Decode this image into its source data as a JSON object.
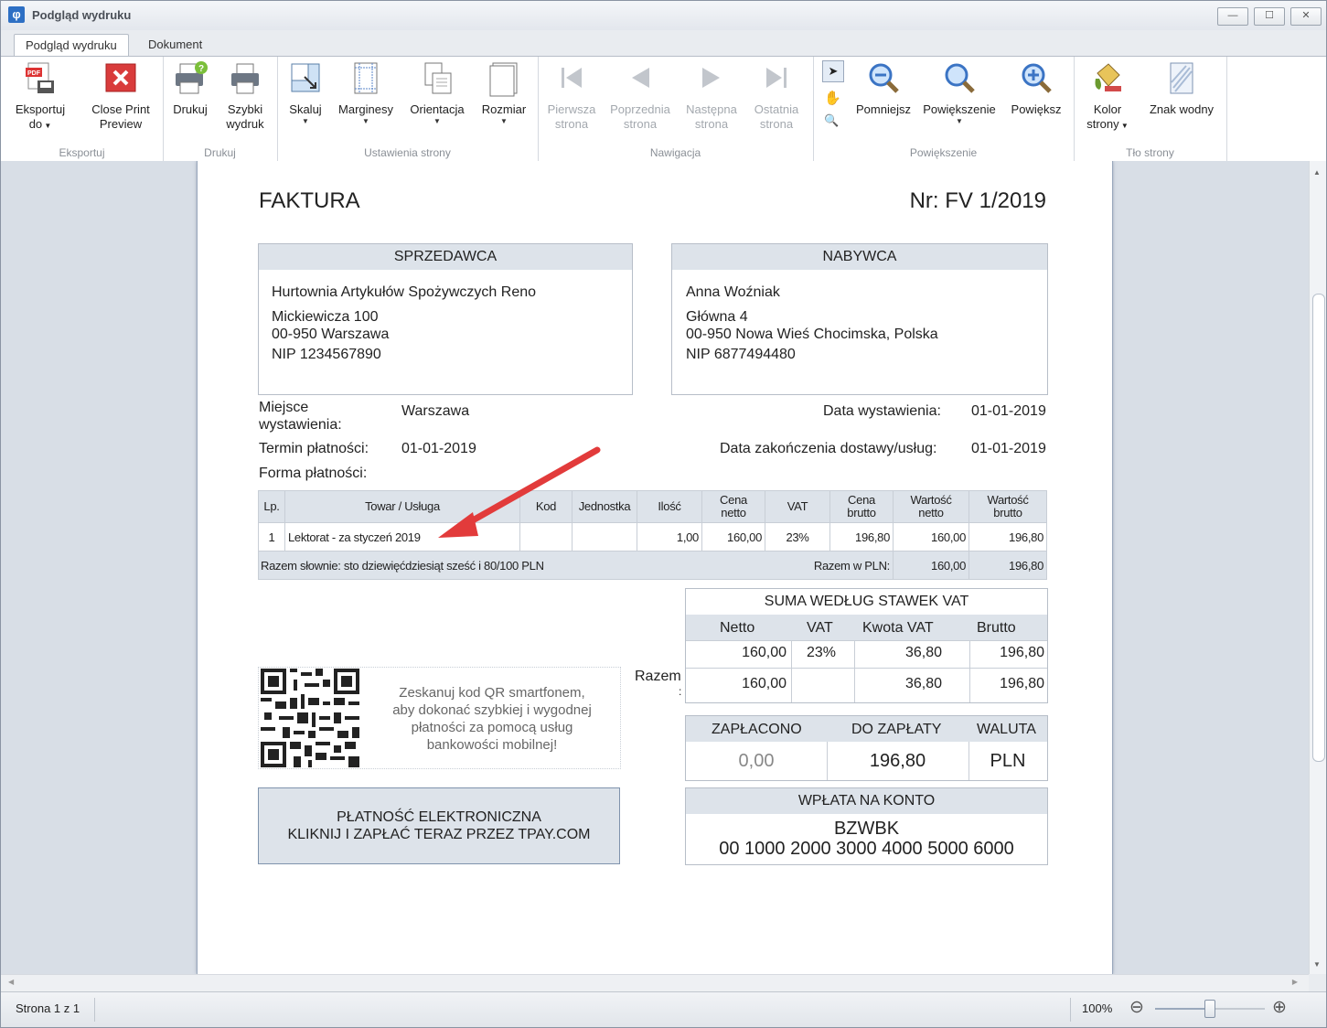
{
  "window": {
    "title": "Podgląd wydruku",
    "min": "—",
    "max": "☐",
    "close": "✕"
  },
  "tabs": [
    "Podgląd wydruku",
    "Dokument"
  ],
  "ribbon": {
    "eksport": {
      "label": "Eksportuj",
      "export": "Eksportuj do",
      "close": "Close Print Preview",
      "export_l1": "Eksportuj",
      "export_l2": "do",
      "close_l1": "Close Print",
      "close_l2": "Preview"
    },
    "druk": {
      "label": "Drukuj",
      "print": "Drukuj",
      "quick_l1": "Szybki",
      "quick_l2": "wydruk"
    },
    "ustawienia": {
      "label": "Ustawienia strony",
      "scale": "Skaluj",
      "margins": "Marginesy",
      "orientation": "Orientacja",
      "size": "Rozmiar"
    },
    "nawigacja": {
      "label": "Nawigacja",
      "first_l1": "Pierwsza",
      "first_l2": "strona",
      "prev_l1": "Poprzednia",
      "prev_l2": "strona",
      "next_l1": "Następna",
      "next_l2": "strona",
      "last_l1": "Ostatnia",
      "last_l2": "strona"
    },
    "powiekszenie": {
      "label": "Powiększenie",
      "zoom_out": "Pomniejsz",
      "zoom": "Powiększenie",
      "zoom_in": "Powiększ"
    },
    "tlo": {
      "label": "Tło strony",
      "color_l1": "Kolor",
      "color_l2": "strony",
      "watermark": "Znak wodny"
    }
  },
  "invoice": {
    "title": "FAKTURA",
    "number": "Nr: FV 1/2019",
    "seller": {
      "header": "SPRZEDAWCA",
      "name": "Hurtownia Artykułów Spożywczych Reno",
      "street": "Mickiewicza 100",
      "city": "00-950 Warszawa",
      "nip": "NIP 1234567890"
    },
    "buyer": {
      "header": "NABYWCA",
      "name": "Anna Woźniak",
      "street": "Główna 4",
      "city": "00-950 Nowa Wieś  Chocimska, Polska",
      "nip": "NIP 6877494480"
    },
    "place_label_1": "Miejsce",
    "place_label_2": "wystawienia:",
    "place_value": "Warszawa",
    "issue_label": "Data wystawienia:",
    "issue_value": "01-01-2019",
    "term_label": "Termin płatności:",
    "term_value": "01-01-2019",
    "delivery_label": "Data zakończenia dostawy/usług:",
    "delivery_value": "01-01-2019",
    "payment_label": "Forma płatności:",
    "table": {
      "headers": [
        "Lp.",
        "Towar / Usługa",
        "Kod",
        "Jednostka",
        "Ilość",
        "Cena netto",
        "VAT",
        "Cena brutto",
        "Wartość netto",
        "Wartość brutto"
      ],
      "h_cena_netto": [
        "Cena",
        "netto"
      ],
      "h_cena_brutto": [
        "Cena",
        "brutto"
      ],
      "h_wart_netto": [
        "Wartość",
        "netto"
      ],
      "h_wart_brutto": [
        "Wartość",
        "brutto"
      ],
      "row": {
        "lp": "1",
        "name": "Lektorat - za styczeń 2019",
        "kod": "",
        "jm": "",
        "qty": "1,00",
        "cena_netto": "160,00",
        "vat": "23%",
        "cena_brutto": "196,80",
        "wart_netto": "160,00",
        "wart_brutto": "196,80"
      },
      "words": "Razem słownie: sto dziewięćdziesiąt sześć i 80/100 PLN",
      "sum_label": "Razem w PLN:",
      "sum_netto": "160,00",
      "sum_brutto": "196,80"
    },
    "vat_summary": {
      "title": "SUMA WEDŁUG STAWEK VAT",
      "headers": [
        "Netto",
        "VAT",
        "Kwota VAT",
        "Brutto"
      ],
      "row": {
        "netto": "160,00",
        "vat": "23%",
        "kwota": "36,80",
        "brutto": "196,80"
      },
      "total_label": "Razem",
      "total_colon": ":",
      "total": {
        "netto": "160,00",
        "kwota": "36,80",
        "brutto": "196,80"
      }
    },
    "qr_text": "Zeskanuj kod QR smartfonem, aby dokonać szybkiej i wygodnej płatności za pomocą usług bankowości mobilnej!",
    "qr_lines": [
      "Zeskanuj kod QR smartfonem,",
      "aby dokonać szybkiej i wygodnej",
      "płatności za pomocą usług",
      "bankowości mobilnej!"
    ],
    "paid": {
      "h1": "ZAPŁACONO",
      "h2": "DO ZAPŁATY",
      "h3": "WALUTA",
      "v1": "0,00",
      "v2": "196,80",
      "v3": "PLN"
    },
    "account": {
      "header": "WPŁATA NA KONTO",
      "bank": "BZWBK",
      "number": "00 1000 2000 3000 4000 5000 6000"
    },
    "pay_button": {
      "line1": "PŁATNOŚĆ ELEKTRONICZNA",
      "line2": "KLIKNIJ I ZAPŁAĆ TERAZ PRZEZ TPAY.COM"
    }
  },
  "status": {
    "page": "Strona 1 z 1",
    "zoom": "100%",
    "zoom_minus": "⊖",
    "zoom_plus": "⊕",
    "zoom_level": 0.5
  },
  "colors": {
    "accent": "#2d6fc4",
    "header_bg": "#dde3ea",
    "arrow": "#e23b3b"
  }
}
